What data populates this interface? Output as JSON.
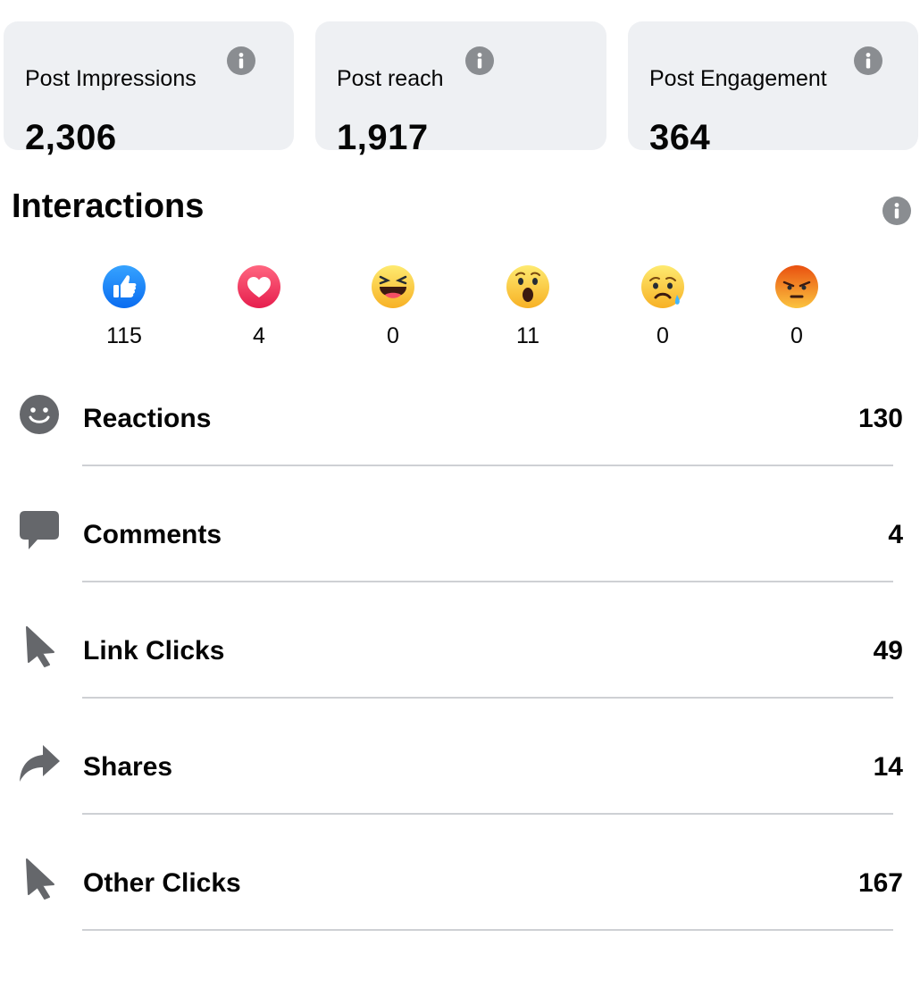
{
  "stats": [
    {
      "label": "Post Impressions",
      "value": "2,306"
    },
    {
      "label": "Post reach",
      "value": "1,917"
    },
    {
      "label": "Post Engagement",
      "value": "364"
    }
  ],
  "interactions": {
    "title": "Interactions",
    "reactions": [
      {
        "icon": "like-reaction-icon",
        "count": "115"
      },
      {
        "icon": "love-reaction-icon",
        "count": "4"
      },
      {
        "icon": "haha-reaction-icon",
        "count": "0"
      },
      {
        "icon": "wow-reaction-icon",
        "count": "11"
      },
      {
        "icon": "sad-reaction-icon",
        "count": "0"
      },
      {
        "icon": "angry-reaction-icon",
        "count": "0"
      }
    ],
    "metrics": [
      {
        "icon": "smiley-icon",
        "label": "Reactions",
        "value": "130"
      },
      {
        "icon": "comment-bubble-icon",
        "label": "Comments",
        "value": "4"
      },
      {
        "icon": "cursor-icon",
        "label": "Link Clicks",
        "value": "49"
      },
      {
        "icon": "share-arrow-icon",
        "label": "Shares",
        "value": "14"
      },
      {
        "icon": "cursor-icon",
        "label": "Other Clicks",
        "value": "167"
      }
    ]
  },
  "colors": {
    "card_bg": "#eef0f3",
    "info_icon": "#8a8d91",
    "metric_icon": "#65676b",
    "divider": "#ced0d4",
    "like_blue": "#1877f2",
    "love_red": "#f33e58",
    "emoji_yellow": "#fcc43f",
    "angry_orange": "#e9710f"
  }
}
